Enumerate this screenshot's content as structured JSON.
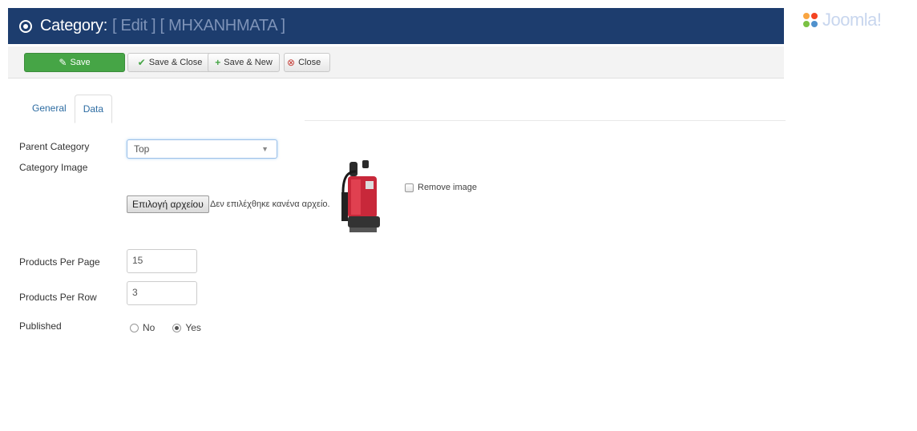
{
  "header": {
    "title": "Category:",
    "subtitle": "[ Edit ] [ ΜΗΧΑΝΗΜΑΤΑ ]"
  },
  "brand": {
    "name": "Joomla!"
  },
  "toolbar": {
    "save_label": "Save",
    "save_close_label": "Save & Close",
    "save_new_label": "Save & New",
    "close_label": "Close"
  },
  "tabs": [
    {
      "label": "General"
    },
    {
      "label": "Data"
    }
  ],
  "form": {
    "parent_category": {
      "label": "Parent Category",
      "value": "Top"
    },
    "category_image": {
      "label": "Category Image",
      "file_button": "Επιλογή αρχείου",
      "file_status": "Δεν επιλέχθηκε κανένα αρχείο.",
      "remove_label": "Remove image"
    },
    "products_per_page": {
      "label": "Products Per Page",
      "value": "15"
    },
    "products_per_row": {
      "label": "Products Per Row",
      "value": "3"
    },
    "published": {
      "label": "Published",
      "options": [
        "No",
        "Yes"
      ],
      "selected": "Yes"
    }
  },
  "colors": {
    "header_bg": "#1d3d6e",
    "save_green": "#46a546",
    "close_red": "#c43c35",
    "link_blue": "#2d6ca2"
  },
  "icons": {
    "title": "target-icon",
    "save": "edit-icon",
    "save_close": "check-icon",
    "save_new": "plus-icon",
    "close": "close-circle-icon",
    "brand": "joomla-logo-icon"
  }
}
